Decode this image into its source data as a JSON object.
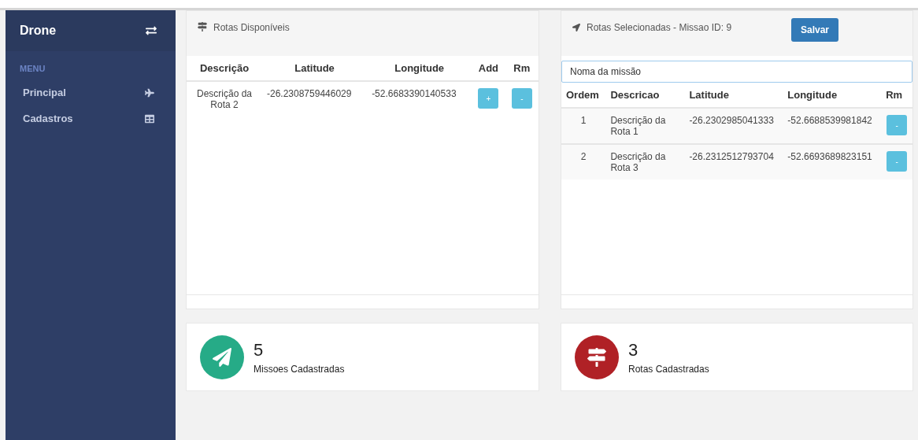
{
  "sidebar": {
    "title": "Drone",
    "section": "MENU",
    "items": [
      {
        "label": "Principal"
      },
      {
        "label": "Cadastros"
      }
    ]
  },
  "available": {
    "title": "Rotas Disponíveis",
    "columns": [
      "Descrição",
      "Latitude",
      "Longitude",
      "Add",
      "Rm"
    ],
    "rows": [
      {
        "description": "Descrição da Rota 2",
        "latitude": "-26.2308759446029",
        "longitude": "-52.6683390140533",
        "add": "+",
        "rm": "-"
      }
    ]
  },
  "selected": {
    "title": "Rotas Selecionadas - Missao ID: 9",
    "save": "Salvar",
    "name_field": {
      "placeholder": "Noma da missão"
    },
    "columns": [
      "Ordem",
      "Descricao",
      "Latitude",
      "Longitude",
      "Rm"
    ],
    "rows": [
      {
        "order": "1",
        "description": "Descrição da Rota 1",
        "latitude": "-26.2302985041333",
        "longitude": "-52.6688539981842",
        "rm": "-"
      },
      {
        "order": "2",
        "description": "Descrição da Rota 3",
        "latitude": "-26.2312512793704",
        "longitude": "-52.6693689823151",
        "rm": "-"
      }
    ]
  },
  "stats": [
    {
      "value": "5",
      "label": "Missoes Cadastradas",
      "color": "#26ab87"
    },
    {
      "value": "3",
      "label": "Rotas Cadastradas",
      "color": "#b02126"
    }
  ]
}
